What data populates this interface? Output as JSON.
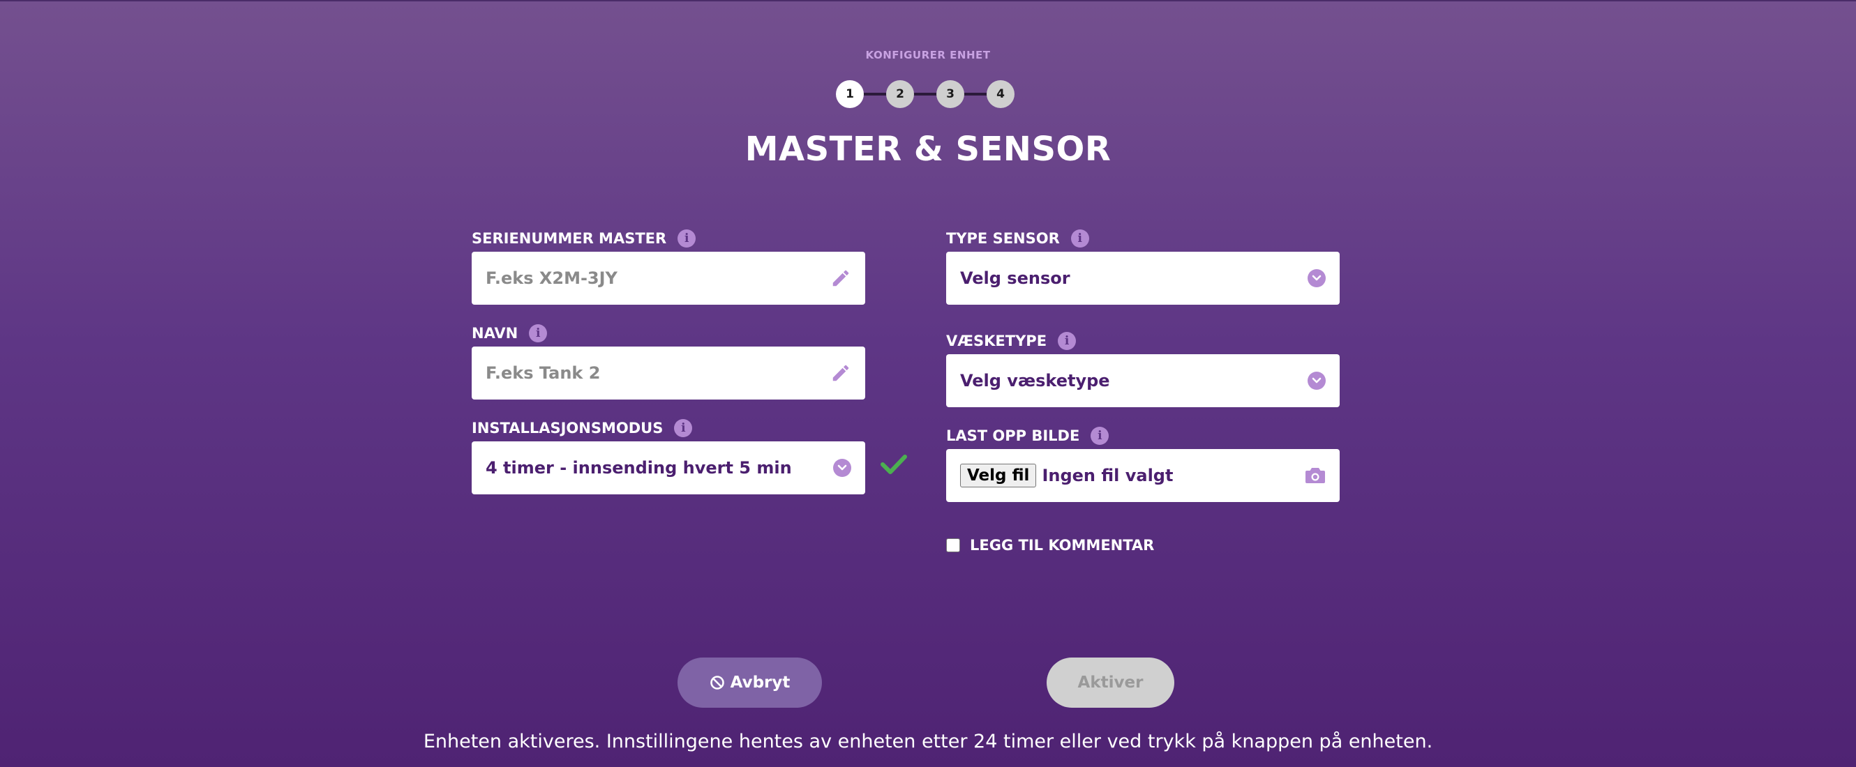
{
  "header": {
    "kicker": "KONFIGURER ENHET",
    "title": "MASTER & SENSOR"
  },
  "stepper": {
    "steps": [
      "1",
      "2",
      "3",
      "4"
    ],
    "active_step": 1
  },
  "form": {
    "serial": {
      "label": "SERIENUMMER MASTER",
      "placeholder": "F.eks X2M-3JY"
    },
    "name": {
      "label": "NAVN",
      "placeholder": "F.eks Tank 2"
    },
    "install_mode": {
      "label": "INSTALLASJONSMODUS",
      "value": "4 timer - innsending hvert 5 min"
    },
    "sensor_type": {
      "label": "TYPE SENSOR",
      "value": "Velg sensor"
    },
    "liquid_type": {
      "label": "VÆSKETYPE",
      "value": "Velg væsketype"
    },
    "upload": {
      "label": "LAST OPP BILDE",
      "button": "Velg fil",
      "status": "Ingen fil valgt"
    },
    "comment": {
      "label": "LEGG TIL KOMMENTAR",
      "checked": false
    }
  },
  "actions": {
    "cancel": "Avbryt",
    "activate": "Aktiver"
  },
  "footer": {
    "note": "Enheten aktiveres. Innstillingene hentes av enheten etter 24 timer eller ved trykk på knappen på enheten."
  },
  "colors": {
    "background_top": "#74508f",
    "background_bottom": "#4f2373",
    "accent": "#b48ad3",
    "value_text": "#4b1f6f",
    "success": "#4caf50",
    "cancel_button": "#7f63a6",
    "disabled_button": "#d0d0d0"
  },
  "icons": {
    "info": "info-icon",
    "edit": "pencil-icon",
    "select": "chevron-down-icon",
    "valid": "check-icon",
    "upload": "camera-icon",
    "cancel": "ban-icon"
  }
}
